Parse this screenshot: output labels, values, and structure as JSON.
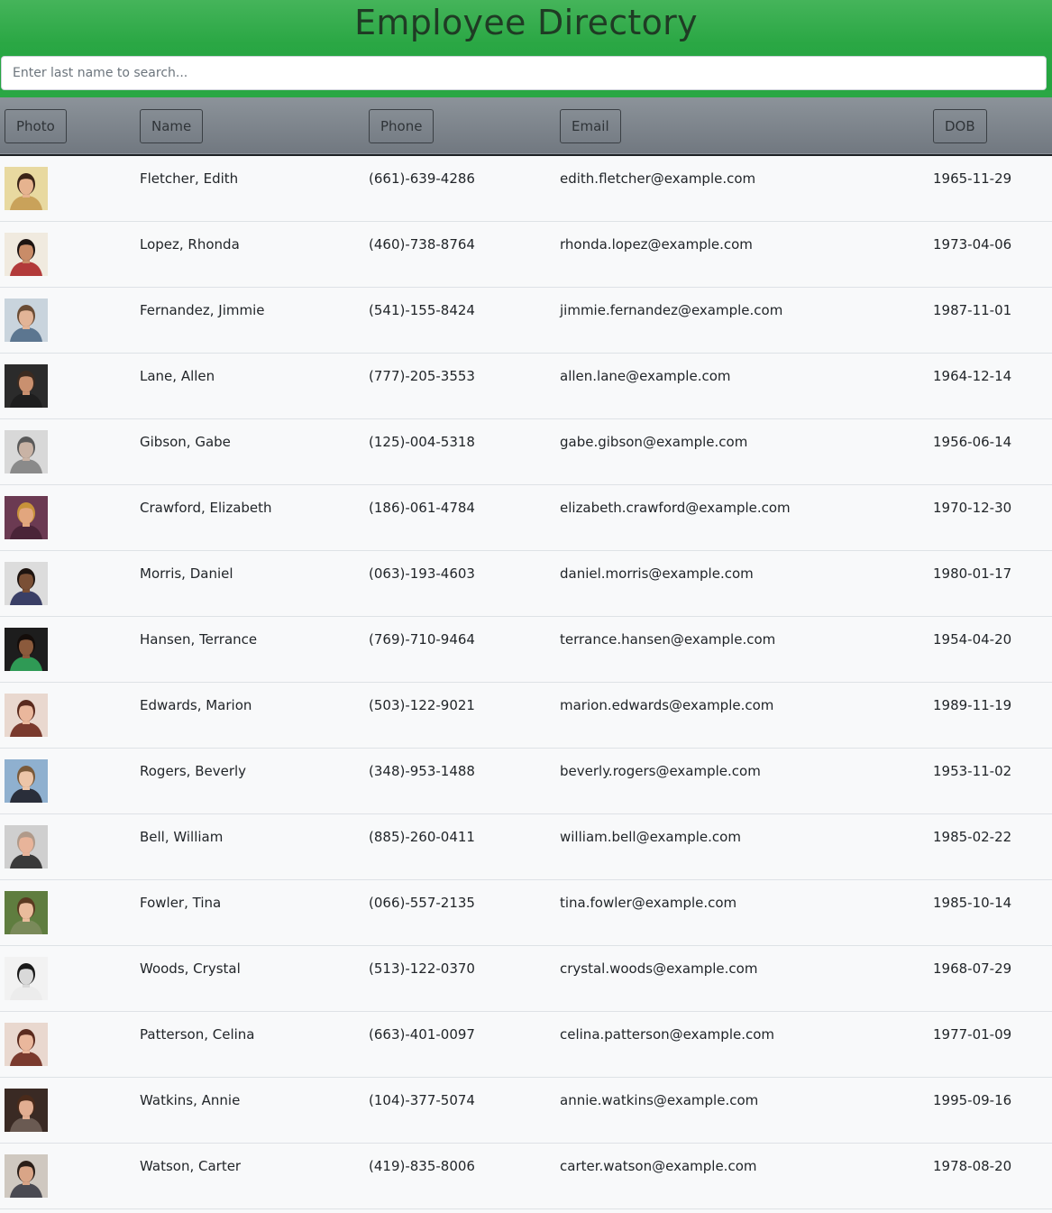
{
  "header": {
    "title": "Employee Directory",
    "search_placeholder": "Enter last name to search..."
  },
  "table": {
    "columns": [
      "Photo",
      "Name",
      "Phone",
      "Email",
      "DOB"
    ],
    "rows": [
      {
        "name": "Fletcher, Edith",
        "phone": "(661)-639-4286",
        "email": "edith.fletcher@example.com",
        "dob": "1965-11-29",
        "photo": {
          "bg": "#e8d9a0",
          "skin": "#e6b38f",
          "hair": "#3a2418",
          "shirt": "#c9a25a"
        }
      },
      {
        "name": "Lopez, Rhonda",
        "phone": "(460)-738-8764",
        "email": "rhonda.lopez@example.com",
        "dob": "1973-04-06",
        "photo": {
          "bg": "#f0eadf",
          "skin": "#c98c68",
          "hair": "#1d1412",
          "shirt": "#b23a3a"
        }
      },
      {
        "name": "Fernandez, Jimmie",
        "phone": "(541)-155-8424",
        "email": "jimmie.fernandez@example.com",
        "dob": "1987-11-01",
        "photo": {
          "bg": "#c9d4dd",
          "skin": "#e2b497",
          "hair": "#6a4c35",
          "shirt": "#5c7690"
        }
      },
      {
        "name": "Lane, Allen",
        "phone": "(777)-205-3553",
        "email": "allen.lane@example.com",
        "dob": "1964-12-14",
        "photo": {
          "bg": "#2b2b2b",
          "skin": "#c9906f",
          "hair": "#3b2a20",
          "shirt": "#1e1e1e"
        }
      },
      {
        "name": "Gibson, Gabe",
        "phone": "(125)-004-5318",
        "email": "gabe.gibson@example.com",
        "dob": "1956-06-14",
        "photo": {
          "bg": "#d8d8d8",
          "skin": "#c9b3a5",
          "hair": "#5a5a5a",
          "shirt": "#8a8a8a"
        }
      },
      {
        "name": "Crawford, Elizabeth",
        "phone": "(186)-061-4784",
        "email": "elizabeth.crawford@example.com",
        "dob": "1970-12-30",
        "photo": {
          "bg": "#6b3a52",
          "skin": "#e2a67e",
          "hair": "#c7923a",
          "shirt": "#4a2438"
        }
      },
      {
        "name": "Morris, Daniel",
        "phone": "(063)-193-4603",
        "email": "daniel.morris@example.com",
        "dob": "1980-01-17",
        "photo": {
          "bg": "#dcdcdc",
          "skin": "#7a4f35",
          "hair": "#1e1410",
          "shirt": "#3a3f66"
        }
      },
      {
        "name": "Hansen, Terrance",
        "phone": "(769)-710-9464",
        "email": "terrance.hansen@example.com",
        "dob": "1954-04-20",
        "photo": {
          "bg": "#1d1d1d",
          "skin": "#8b5a3c",
          "hair": "#140d0a",
          "shirt": "#2f9a55"
        }
      },
      {
        "name": "Edwards, Marion",
        "phone": "(503)-122-9021",
        "email": "marion.edwards@example.com",
        "dob": "1989-11-19",
        "photo": {
          "bg": "#e9d8cf",
          "skin": "#eab79c",
          "hair": "#5a2a1e",
          "shirt": "#7a3a2e"
        }
      },
      {
        "name": "Rogers, Beverly",
        "phone": "(348)-953-1488",
        "email": "beverly.rogers@example.com",
        "dob": "1953-11-02",
        "photo": {
          "bg": "#8fb0cf",
          "skin": "#ecc5a8",
          "hair": "#7a5a3a",
          "shirt": "#2a2e3a"
        }
      },
      {
        "name": "Bell, William",
        "phone": "(885)-260-0411",
        "email": "william.bell@example.com",
        "dob": "1985-02-22",
        "photo": {
          "bg": "#cfcfcf",
          "skin": "#e8b49a",
          "hair": "#b09a8a",
          "shirt": "#3a3a3a"
        }
      },
      {
        "name": "Fowler, Tina",
        "phone": "(066)-557-2135",
        "email": "tina.fowler@example.com",
        "dob": "1985-10-14",
        "photo": {
          "bg": "#5f7d3f",
          "skin": "#e9bc9c",
          "hair": "#5a3a20",
          "shirt": "#7a8a5a"
        }
      },
      {
        "name": "Woods, Crystal",
        "phone": "(513)-122-0370",
        "email": "crystal.woods@example.com",
        "dob": "1968-07-29",
        "photo": {
          "bg": "#f2f2f2",
          "skin": "#d9d9d9",
          "hair": "#1a1a1a",
          "shirt": "#ececec"
        }
      },
      {
        "name": "Patterson, Celina",
        "phone": "(663)-401-0097",
        "email": "celina.patterson@example.com",
        "dob": "1977-01-09",
        "photo": {
          "bg": "#e9d8cf",
          "skin": "#eab79c",
          "hair": "#5a2a1e",
          "shirt": "#7a3a2e"
        }
      },
      {
        "name": "Watkins, Annie",
        "phone": "(104)-377-5074",
        "email": "annie.watkins@example.com",
        "dob": "1995-09-16",
        "photo": {
          "bg": "#3a2a24",
          "skin": "#e2ae92",
          "hair": "#4a2a1a",
          "shirt": "#6a5a52"
        }
      },
      {
        "name": "Watson, Carter",
        "phone": "(419)-835-8006",
        "email": "carter.watson@example.com",
        "dob": "1978-08-20",
        "photo": {
          "bg": "#cfc8c0",
          "skin": "#d9a587",
          "hair": "#2a1e18",
          "shirt": "#4a4a52"
        }
      }
    ]
  }
}
